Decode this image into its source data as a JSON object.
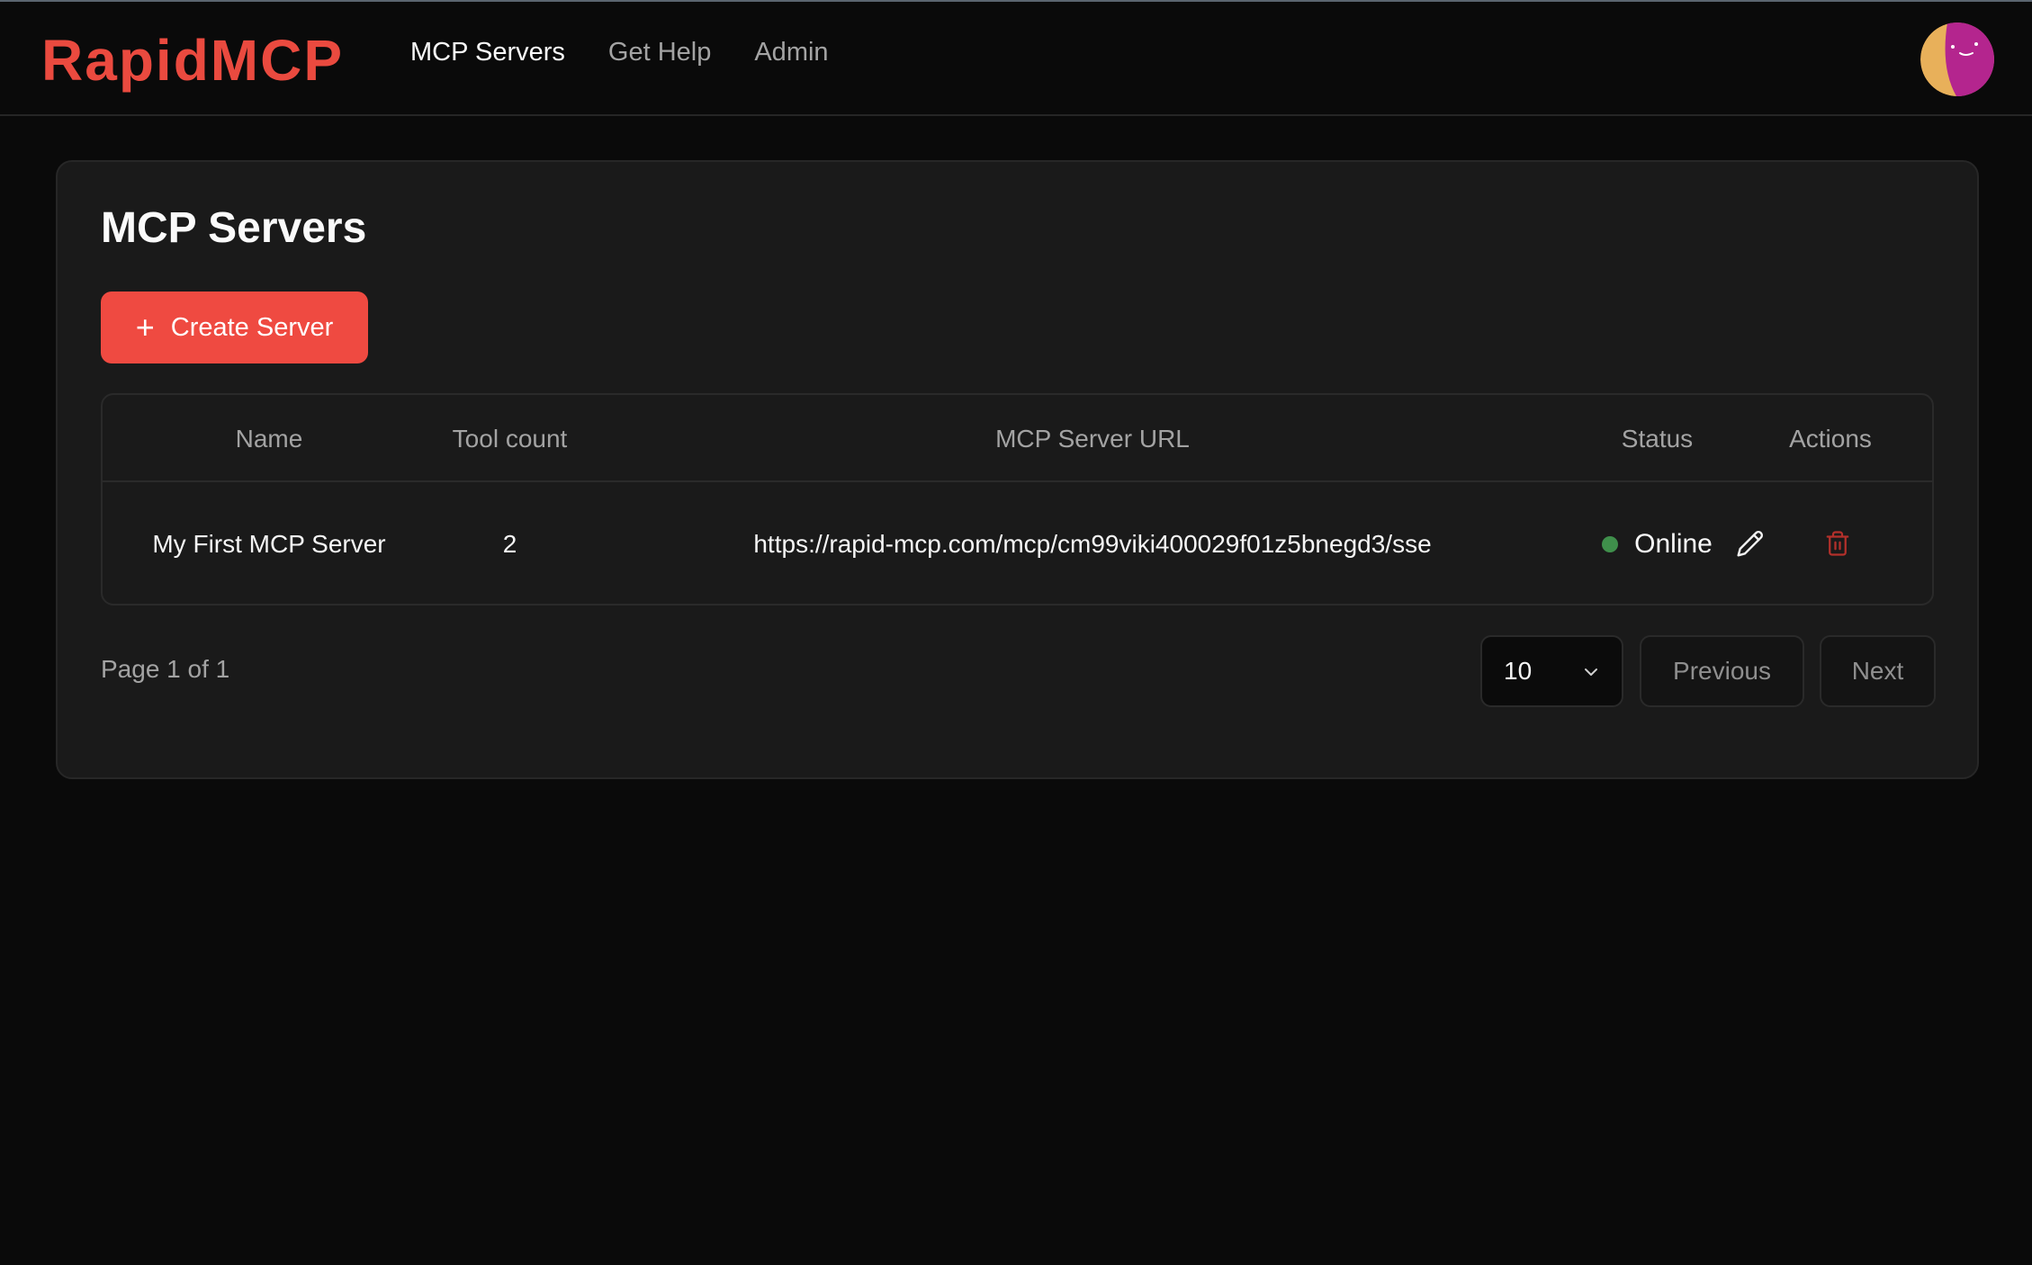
{
  "app": {
    "logo_text": "RapidMCP",
    "nav": [
      {
        "label": "MCP Servers",
        "active": true
      },
      {
        "label": "Get Help",
        "active": false
      },
      {
        "label": "Admin",
        "active": false
      }
    ],
    "avatar_icon": "smiley-avatar-icon"
  },
  "main": {
    "title": "MCP Servers",
    "create_button_label": "Create Server",
    "table": {
      "columns": [
        "Name",
        "Tool count",
        "MCP Server URL",
        "Status",
        "Actions"
      ],
      "rows": [
        {
          "name": "My First MCP Server",
          "tool_count": "2",
          "url": "https://rapid-mcp.com/mcp/cm99viki400029f01z5bnegd3/sse",
          "status": "Online"
        }
      ]
    },
    "pagination": {
      "info": "Page 1 of 1",
      "page_size": "10",
      "previous_label": "Previous",
      "next_label": "Next"
    }
  },
  "colors": {
    "accent": "#ef4a41",
    "status_online": "#3f8f4b",
    "delete_icon": "#b3302b"
  }
}
